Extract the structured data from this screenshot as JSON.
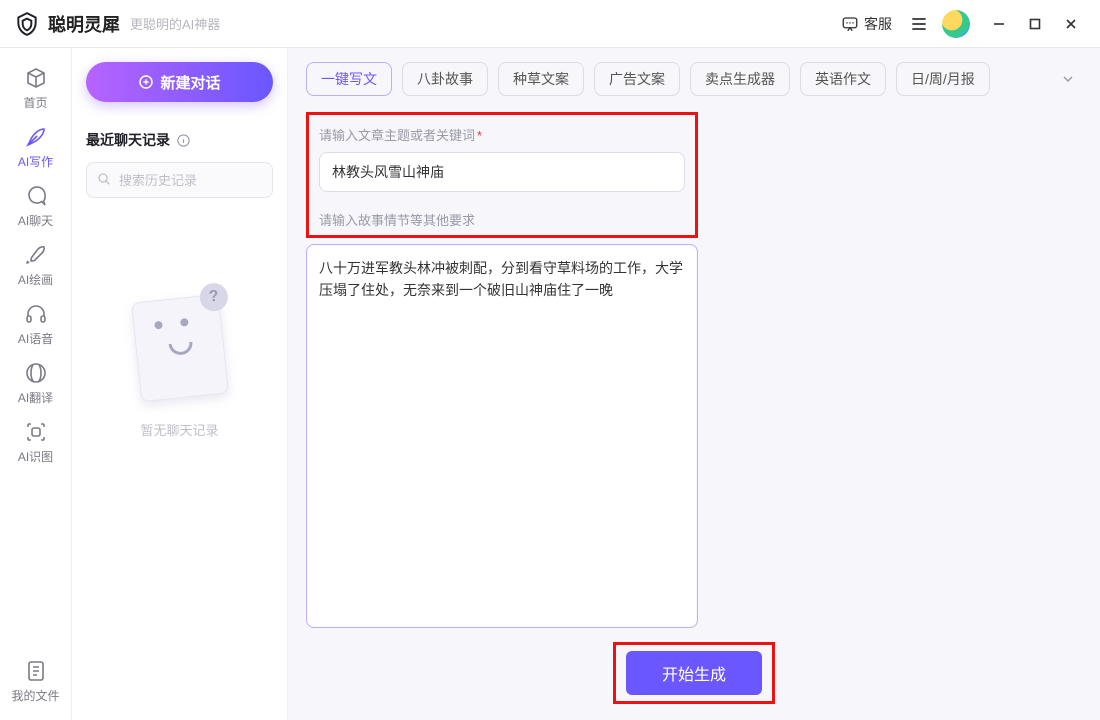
{
  "header": {
    "app_title": "聪明灵犀",
    "tagline": "更聪明的AI神器",
    "support_label": "客服"
  },
  "sidebar": {
    "items": [
      {
        "label": "首页",
        "active": false
      },
      {
        "label": "AI写作",
        "active": true
      },
      {
        "label": "AI聊天",
        "active": false
      },
      {
        "label": "AI绘画",
        "active": false
      },
      {
        "label": "AI语音",
        "active": false
      },
      {
        "label": "AI翻译",
        "active": false
      },
      {
        "label": "AI识图",
        "active": false
      }
    ],
    "files_label": "我的文件"
  },
  "midcol": {
    "new_chat": "新建对话",
    "recent_title": "最近聊天记录",
    "search_placeholder": "搜索历史记录",
    "empty_text": "暂无聊天记录"
  },
  "tags": [
    {
      "label": "一键写文",
      "active": true
    },
    {
      "label": "八卦故事",
      "active": false
    },
    {
      "label": "种草文案",
      "active": false
    },
    {
      "label": "广告文案",
      "active": false
    },
    {
      "label": "卖点生成器",
      "active": false
    },
    {
      "label": "英语作文",
      "active": false
    },
    {
      "label": "日/周/月报",
      "active": false
    }
  ],
  "form": {
    "topic_label": "请输入文章主题或者关键词",
    "topic_value": "林教头风雪山神庙",
    "details_label": "请输入故事情节等其他要求",
    "details_value": "八十万进军教头林冲被刺配，分到看守草料场的工作，大学压塌了住处，无奈来到一个破旧山神庙住了一晚",
    "generate_label": "开始生成"
  }
}
